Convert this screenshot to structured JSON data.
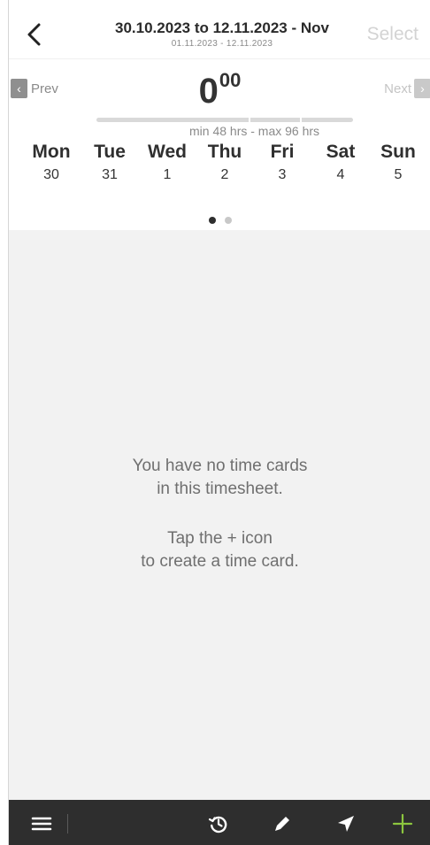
{
  "header": {
    "title": "30.10.2023 to 12.11.2023 - Nov",
    "subtitle": "01.11.2023 - 12.11.2023",
    "select_label": "Select"
  },
  "navigation": {
    "prev_label": "Prev",
    "next_label": "Next"
  },
  "hours": {
    "hours_value": "0",
    "minutes_value": "00",
    "range_label": "min 48 hrs - max 96 hrs"
  },
  "days": [
    {
      "name": "Mon",
      "date": "30"
    },
    {
      "name": "Tue",
      "date": "31"
    },
    {
      "name": "Wed",
      "date": "1"
    },
    {
      "name": "Thu",
      "date": "2"
    },
    {
      "name": "Fri",
      "date": "3"
    },
    {
      "name": "Sat",
      "date": "4"
    },
    {
      "name": "Sun",
      "date": "5"
    }
  ],
  "pager": {
    "page_count": 2,
    "active_page": 1
  },
  "empty_state": {
    "line1": "You have no time cards",
    "line2": "in this timesheet.",
    "line3": "Tap the + icon",
    "line4": "to create a time card."
  },
  "tabbar": {
    "icons": [
      "menu-icon",
      "history-icon",
      "edit-icon",
      "send-icon",
      "add-icon"
    ],
    "add_color": "#8cc63f"
  },
  "colors": {
    "tabbar_bg": "#2e2e2e",
    "accent_green": "#8cc63f"
  }
}
